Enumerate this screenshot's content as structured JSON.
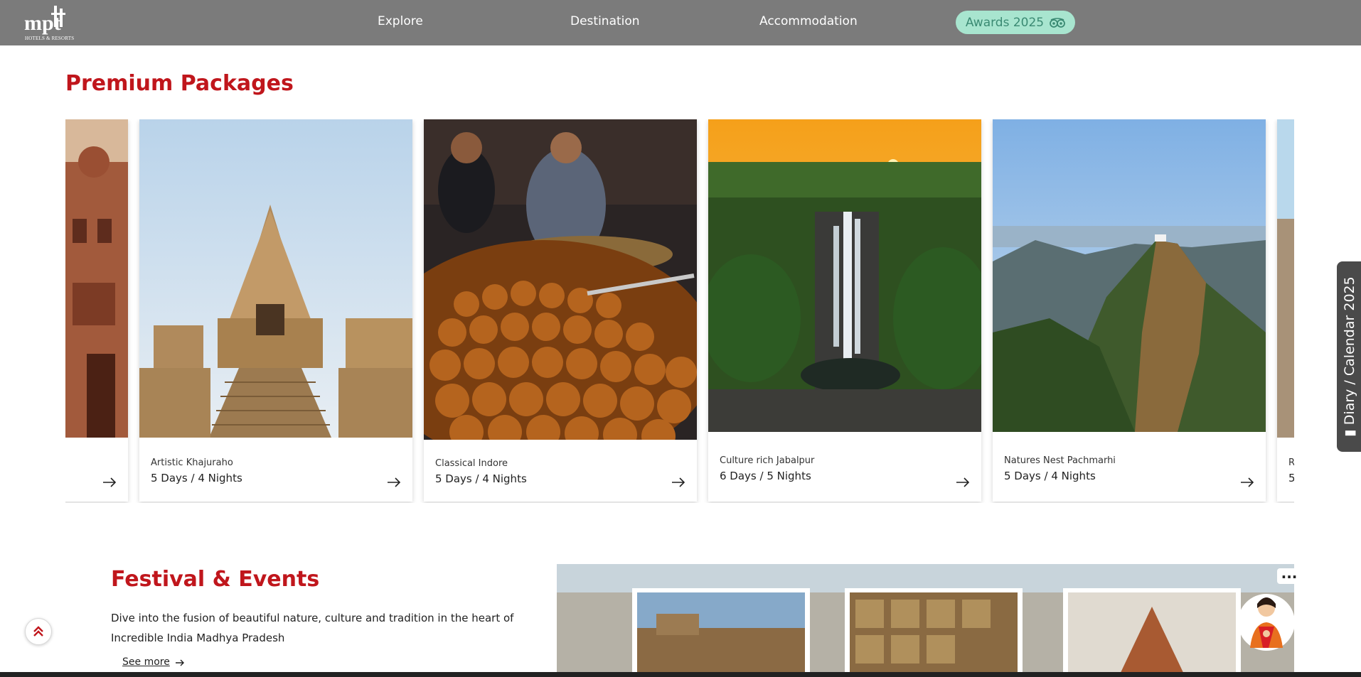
{
  "brand": {
    "logo_text": "mpt",
    "subtitle": "HOTELS & RESORTS"
  },
  "nav": {
    "links": [
      "Explore",
      "Destination",
      "Accommodation"
    ],
    "awards_label": "Awards 2025",
    "awards_icon": "tripadvisor-owl-icon"
  },
  "packages": {
    "title": "Premium Packages",
    "cards": [
      {
        "place": "",
        "duration": ""
      },
      {
        "place": "Artistic Khajuraho",
        "duration": "5 Days / 4 Nights"
      },
      {
        "place": "Classical Indore",
        "duration": "5 Days / 4 Nights"
      },
      {
        "place": "Culture rich Jabalpur",
        "duration": "6 Days / 5 Nights"
      },
      {
        "place": "Natures Nest Pachmarhi",
        "duration": "5 Days / 4 Nights"
      },
      {
        "place": "R",
        "duration": "5"
      }
    ]
  },
  "diary": {
    "label": "Diary / Calendar 2025"
  },
  "festival": {
    "title": "Festival & Events",
    "description": "Dive into the fusion of beautiful nature, culture and tradition in the heart of Incredible India Madhya Pradesh",
    "see_more": "See more"
  },
  "chat": {
    "more_label": "..."
  },
  "colors": {
    "accent": "#c0161c",
    "nav_bg": "#7b7b7b",
    "awards_bg": "#a8e5cf",
    "diary_bg": "#4a4a4a"
  }
}
